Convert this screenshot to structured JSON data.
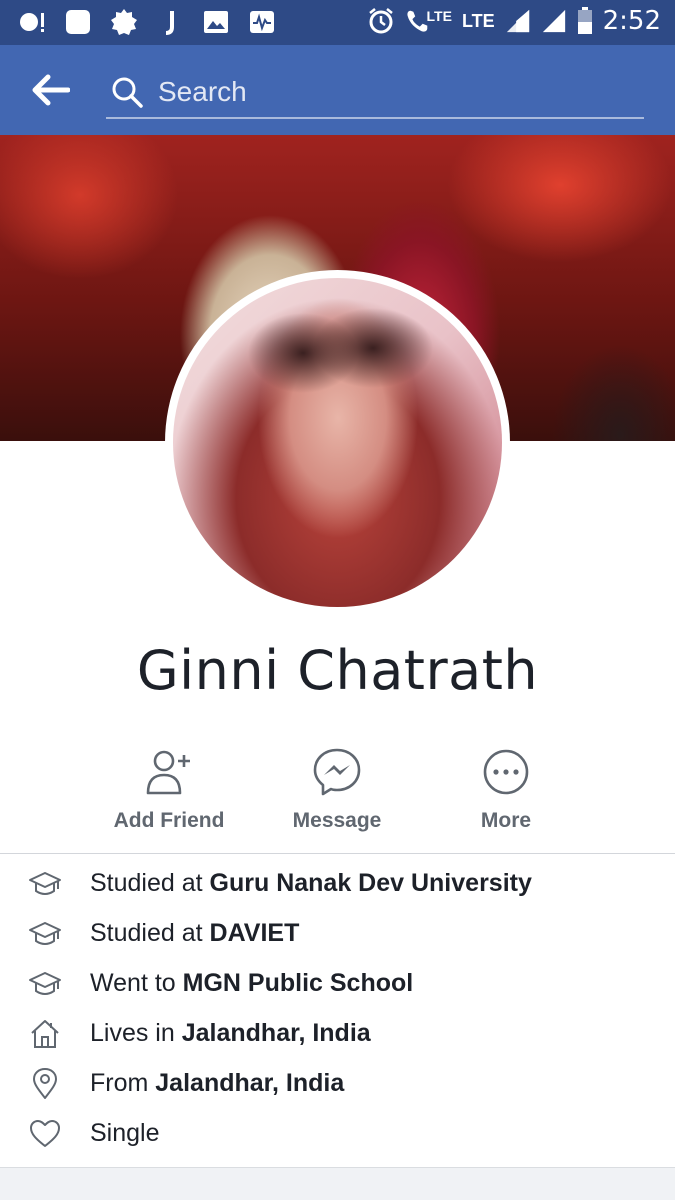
{
  "status_bar": {
    "lte_label_1": "LTE",
    "lte_label_2": "LTE",
    "time": "2:52"
  },
  "header": {
    "search_placeholder": "Search"
  },
  "profile": {
    "name": "Ginni Chatrath"
  },
  "actions": [
    {
      "label": "Add Friend",
      "icon": "add-friend-icon"
    },
    {
      "label": "Message",
      "icon": "messenger-icon"
    },
    {
      "label": "More",
      "icon": "more-icon"
    }
  ],
  "intro": [
    {
      "prefix": "Studied at ",
      "value": "Guru Nanak Dev University",
      "icon": "graduation-cap-icon"
    },
    {
      "prefix": "Studied at ",
      "value": "DAVIET",
      "icon": "graduation-cap-icon"
    },
    {
      "prefix": "Went to ",
      "value": "MGN Public School",
      "icon": "graduation-cap-icon"
    },
    {
      "prefix": "Lives in ",
      "value": "Jalandhar, India",
      "icon": "home-icon"
    },
    {
      "prefix": "From ",
      "value": "Jalandhar, India",
      "icon": "location-pin-icon"
    },
    {
      "prefix": "Single",
      "value": "",
      "icon": "heart-icon"
    }
  ],
  "colors": {
    "brand_blue": "#4267b2",
    "status_bar": "#2e4a86",
    "text_primary": "#1d2129",
    "text_secondary": "#606770"
  }
}
